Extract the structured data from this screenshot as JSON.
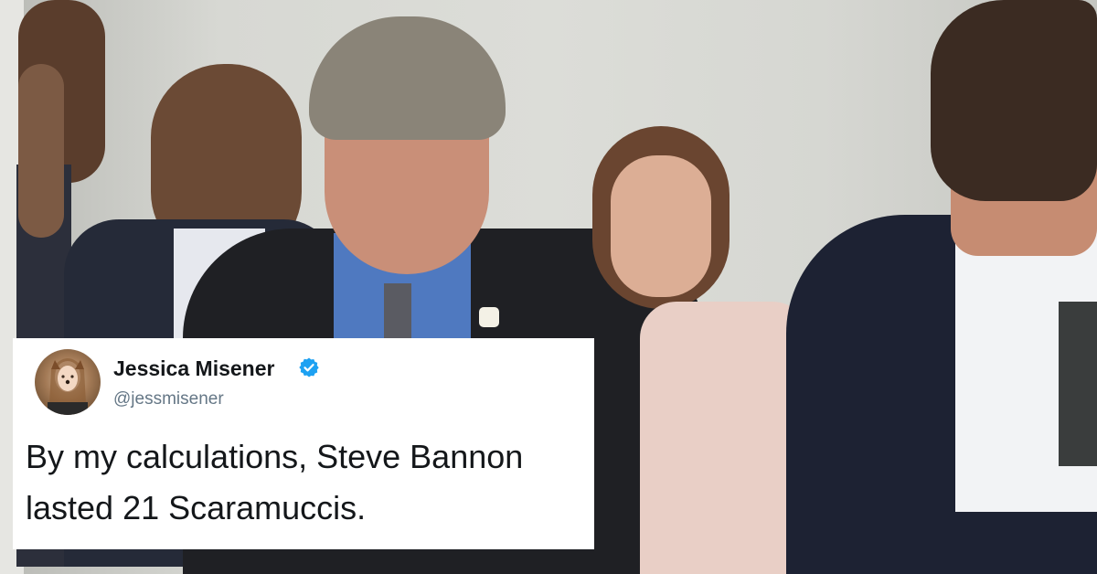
{
  "tweet": {
    "author_name": "Jessica Misener",
    "handle": "@jessmisener",
    "text": "By my calculations, Steve Bannon lasted 21 Scaramuccis.",
    "verified_color": "#1da1f2"
  },
  "photo": {
    "icon": "news-photo"
  }
}
